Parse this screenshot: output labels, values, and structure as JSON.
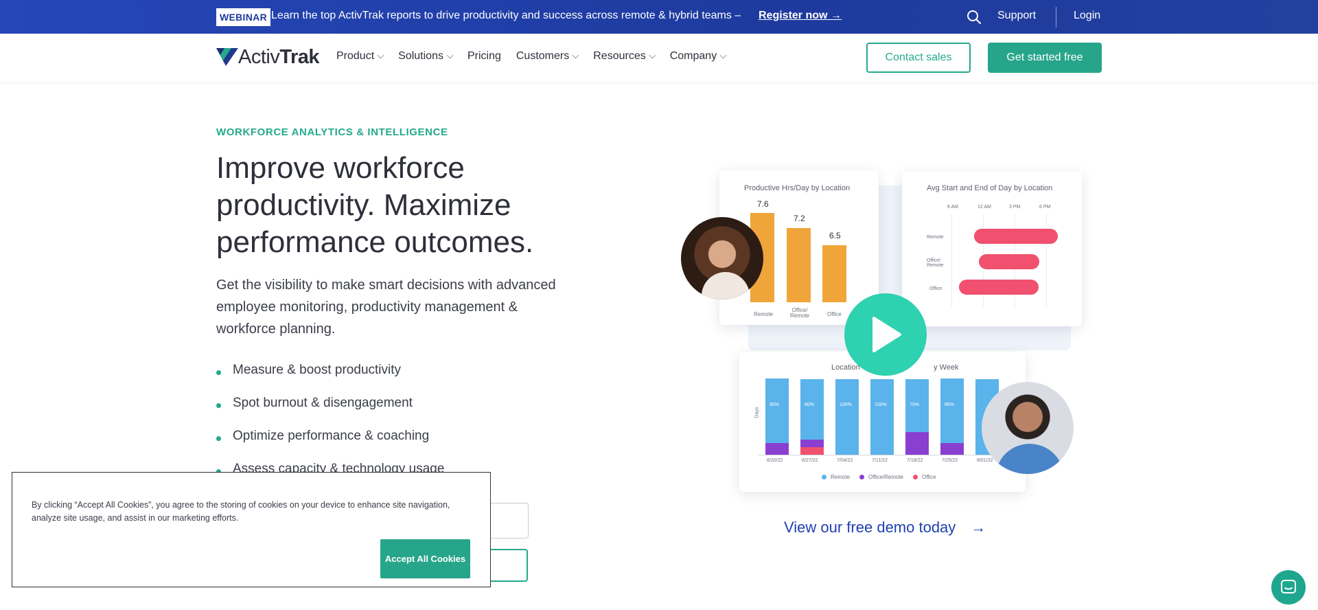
{
  "banner": {
    "badge": "WEBINAR",
    "message": "Learn the top ActivTrak reports to drive productivity and success across remote & hybrid teams –",
    "register": "Register now →",
    "support": "Support",
    "login": "Login"
  },
  "nav": {
    "logo_activ": "Activ",
    "logo_trak": "Trak",
    "items": [
      {
        "label": "Product",
        "dropdown": true
      },
      {
        "label": "Solutions",
        "dropdown": true
      },
      {
        "label": "Pricing",
        "dropdown": false
      },
      {
        "label": "Customers",
        "dropdown": true
      },
      {
        "label": "Resources",
        "dropdown": true
      },
      {
        "label": "Company",
        "dropdown": true
      }
    ],
    "contact_sales": "Contact sales",
    "get_started": "Get started free"
  },
  "hero": {
    "eyebrow": "WORKFORCE ANALYTICS & INTELLIGENCE",
    "headline": "Improve workforce productivity. Maximize performance outcomes.",
    "subtext": "Get the visibility to make smart decisions with advanced employee monitoring, productivity management & workforce planning.",
    "bullets": [
      "Measure & boost productivity",
      "Spot burnout & disengagement",
      "Optimize performance & coaching",
      "Assess capacity & technology usage"
    ]
  },
  "cookie": {
    "text": "By clicking “Accept All Cookies”, you agree to the storing of cookies on your device to enhance site navigation, analyze site usage, and assist in our marketing efforts.",
    "accept": "Accept All Cookies"
  },
  "dashboard": {
    "productive": {
      "title": "Productive Hrs/Day by Location",
      "bars": [
        {
          "label": "Remote",
          "value": "7.6"
        },
        {
          "label": "Office/ Remote",
          "value": "7.2"
        },
        {
          "label": "Office",
          "value": "6.5"
        }
      ]
    },
    "startend": {
      "title": "Avg Start and End of Day by Location",
      "times": [
        "6 AM",
        "12 AM",
        "3 PM",
        "6 PM"
      ],
      "rows": [
        "Remote",
        "Office/ Remote",
        "Office"
      ]
    },
    "weekly": {
      "title_left": "Location",
      "title_right": "y Week",
      "y_label": "Days",
      "dates": [
        "6/20/22",
        "6/27/22",
        "7/04/22",
        "7/11/22",
        "7/18/22",
        "7/25/22",
        "8/01/22"
      ],
      "pcts": [
        "85%",
        "80%",
        "100%",
        "100%",
        "70%",
        "85%",
        ""
      ],
      "legend": [
        "Remote",
        "Office/Remote",
        "Office"
      ]
    },
    "colors": {
      "orange": "#f0a53a",
      "pink": "#f1516e",
      "blue": "#5ab3ea",
      "purple": "#8a3fd0",
      "teal": "#2ed1b0"
    }
  },
  "demo_link": "View our free demo today"
}
